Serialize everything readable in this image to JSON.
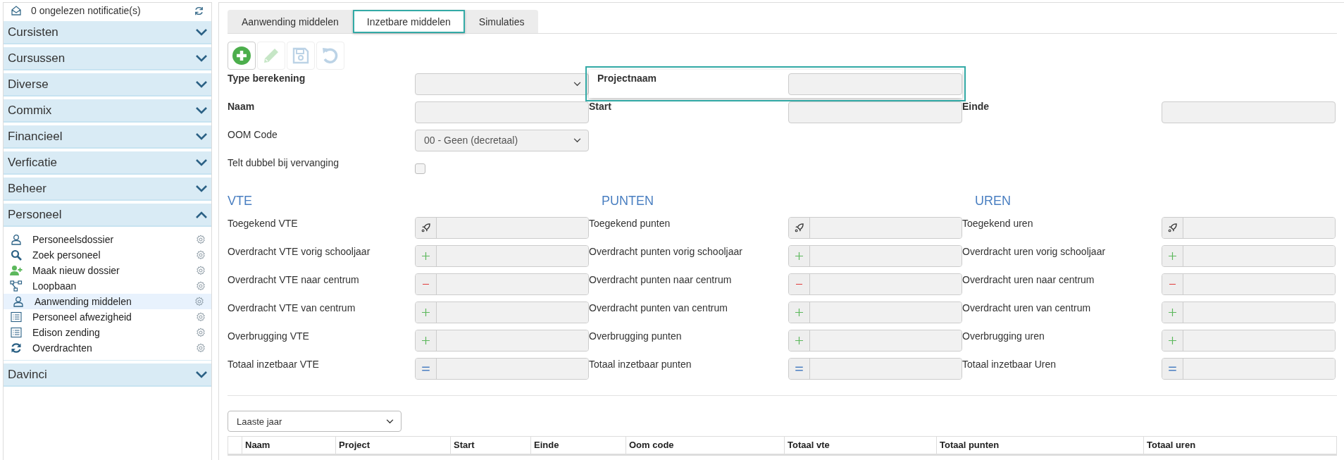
{
  "sidebar": {
    "notification": "0 ongelezen notificatie(s)",
    "groups": [
      {
        "title": "Cursisten",
        "expanded": false
      },
      {
        "title": "Cursussen",
        "expanded": false
      },
      {
        "title": "Diverse",
        "expanded": false
      },
      {
        "title": "Commix",
        "expanded": false
      },
      {
        "title": "Financieel",
        "expanded": false
      },
      {
        "title": "Verficatie",
        "expanded": false
      },
      {
        "title": "Beheer",
        "expanded": false
      },
      {
        "title": "Personeel",
        "expanded": true,
        "items": [
          {
            "label": "Personeelsdossier",
            "kind": "person",
            "selected": false
          },
          {
            "label": "Zoek personeel",
            "kind": "search",
            "selected": false
          },
          {
            "label": "Maak nieuw dossier",
            "kind": "add-person",
            "selected": false
          },
          {
            "label": "Loopbaan",
            "kind": "tree",
            "selected": false
          },
          {
            "label": "Aanwending middelen",
            "kind": "person",
            "selected": true
          },
          {
            "label": "Personeel afwezigheid",
            "kind": "list",
            "selected": false
          },
          {
            "label": "Edison zending",
            "kind": "list",
            "selected": false
          },
          {
            "label": "Overdrachten",
            "kind": "sync",
            "selected": false
          }
        ]
      },
      {
        "title": "Davinci",
        "expanded": false
      }
    ]
  },
  "tabs": [
    {
      "label": "Aanwending middelen",
      "selected": false
    },
    {
      "label": "Inzetbare middelen",
      "selected": true
    },
    {
      "label": "Simulaties",
      "selected": false
    }
  ],
  "toolbar": [
    {
      "kind": "add",
      "disabled": false
    },
    {
      "kind": "edit",
      "disabled": true
    },
    {
      "kind": "save",
      "disabled": true
    },
    {
      "kind": "undo",
      "disabled": true
    }
  ],
  "top_rows": [
    [
      {
        "label": "Type berekening",
        "kind": "select",
        "bold": true,
        "focused": false
      },
      {
        "label": "Projectnaam",
        "kind": "text",
        "bold": true,
        "focused": true
      }
    ],
    [
      {
        "label": "Naam",
        "kind": "text",
        "bold": true,
        "focused": false
      },
      {
        "label": "Start",
        "kind": "text",
        "bold": true,
        "focused": false
      },
      {
        "label": "Einde",
        "kind": "text",
        "bold": true,
        "focused": false
      }
    ],
    [
      {
        "label": "OOM Code",
        "kind": "select",
        "value": "00 - Geen (decretaal)",
        "bold": false,
        "focused": false
      }
    ],
    [
      {
        "label": "Telt dubbel bij vervanging",
        "kind": "checkbox",
        "checked": false,
        "bold": false,
        "focused": false
      }
    ]
  ],
  "sections": [
    {
      "title": "VTE",
      "rows": [
        {
          "label": "Toegekend VTE",
          "kind": "rocket"
        },
        {
          "label": "Overdracht VTE vorig schooljaar",
          "kind": "plus"
        },
        {
          "label": "Overdracht VTE naar centrum",
          "kind": "minus"
        },
        {
          "label": "Overdracht VTE van centrum",
          "kind": "plus"
        },
        {
          "label": "Overbrugging VTE",
          "kind": "plus"
        },
        {
          "label": "Totaal inzetbaar VTE",
          "kind": "equals"
        }
      ]
    },
    {
      "title": "PUNTEN",
      "rows": [
        {
          "label": "Toegekend punten",
          "kind": "rocket"
        },
        {
          "label": "Overdracht punten vorig schooljaar",
          "kind": "plus"
        },
        {
          "label": "Overdracht punten naar centrum",
          "kind": "minus"
        },
        {
          "label": "Overdracht punten van centrum",
          "kind": "plus"
        },
        {
          "label": "Overbrugging punten",
          "kind": "plus"
        },
        {
          "label": "Totaal inzetbaar punten",
          "kind": "equals"
        }
      ]
    },
    {
      "title": "UREN",
      "rows": [
        {
          "label": "Toegekend uren",
          "kind": "rocket"
        },
        {
          "label": "Overdracht uren vorig schooljaar",
          "kind": "plus"
        },
        {
          "label": "Overdracht uren naar centrum",
          "kind": "minus"
        },
        {
          "label": "Overdracht uren van centrum",
          "kind": "plus"
        },
        {
          "label": "Overbrugging uren",
          "kind": "plus"
        },
        {
          "label": "Totaal inzetbaar Uren",
          "kind": "equals"
        }
      ]
    }
  ],
  "table": {
    "period": "Laaste jaar",
    "columns": [
      "Naam",
      "Project",
      "Start",
      "Einde",
      "Oom code",
      "Totaal vte",
      "Totaal punten",
      "Totaal uren"
    ]
  }
}
